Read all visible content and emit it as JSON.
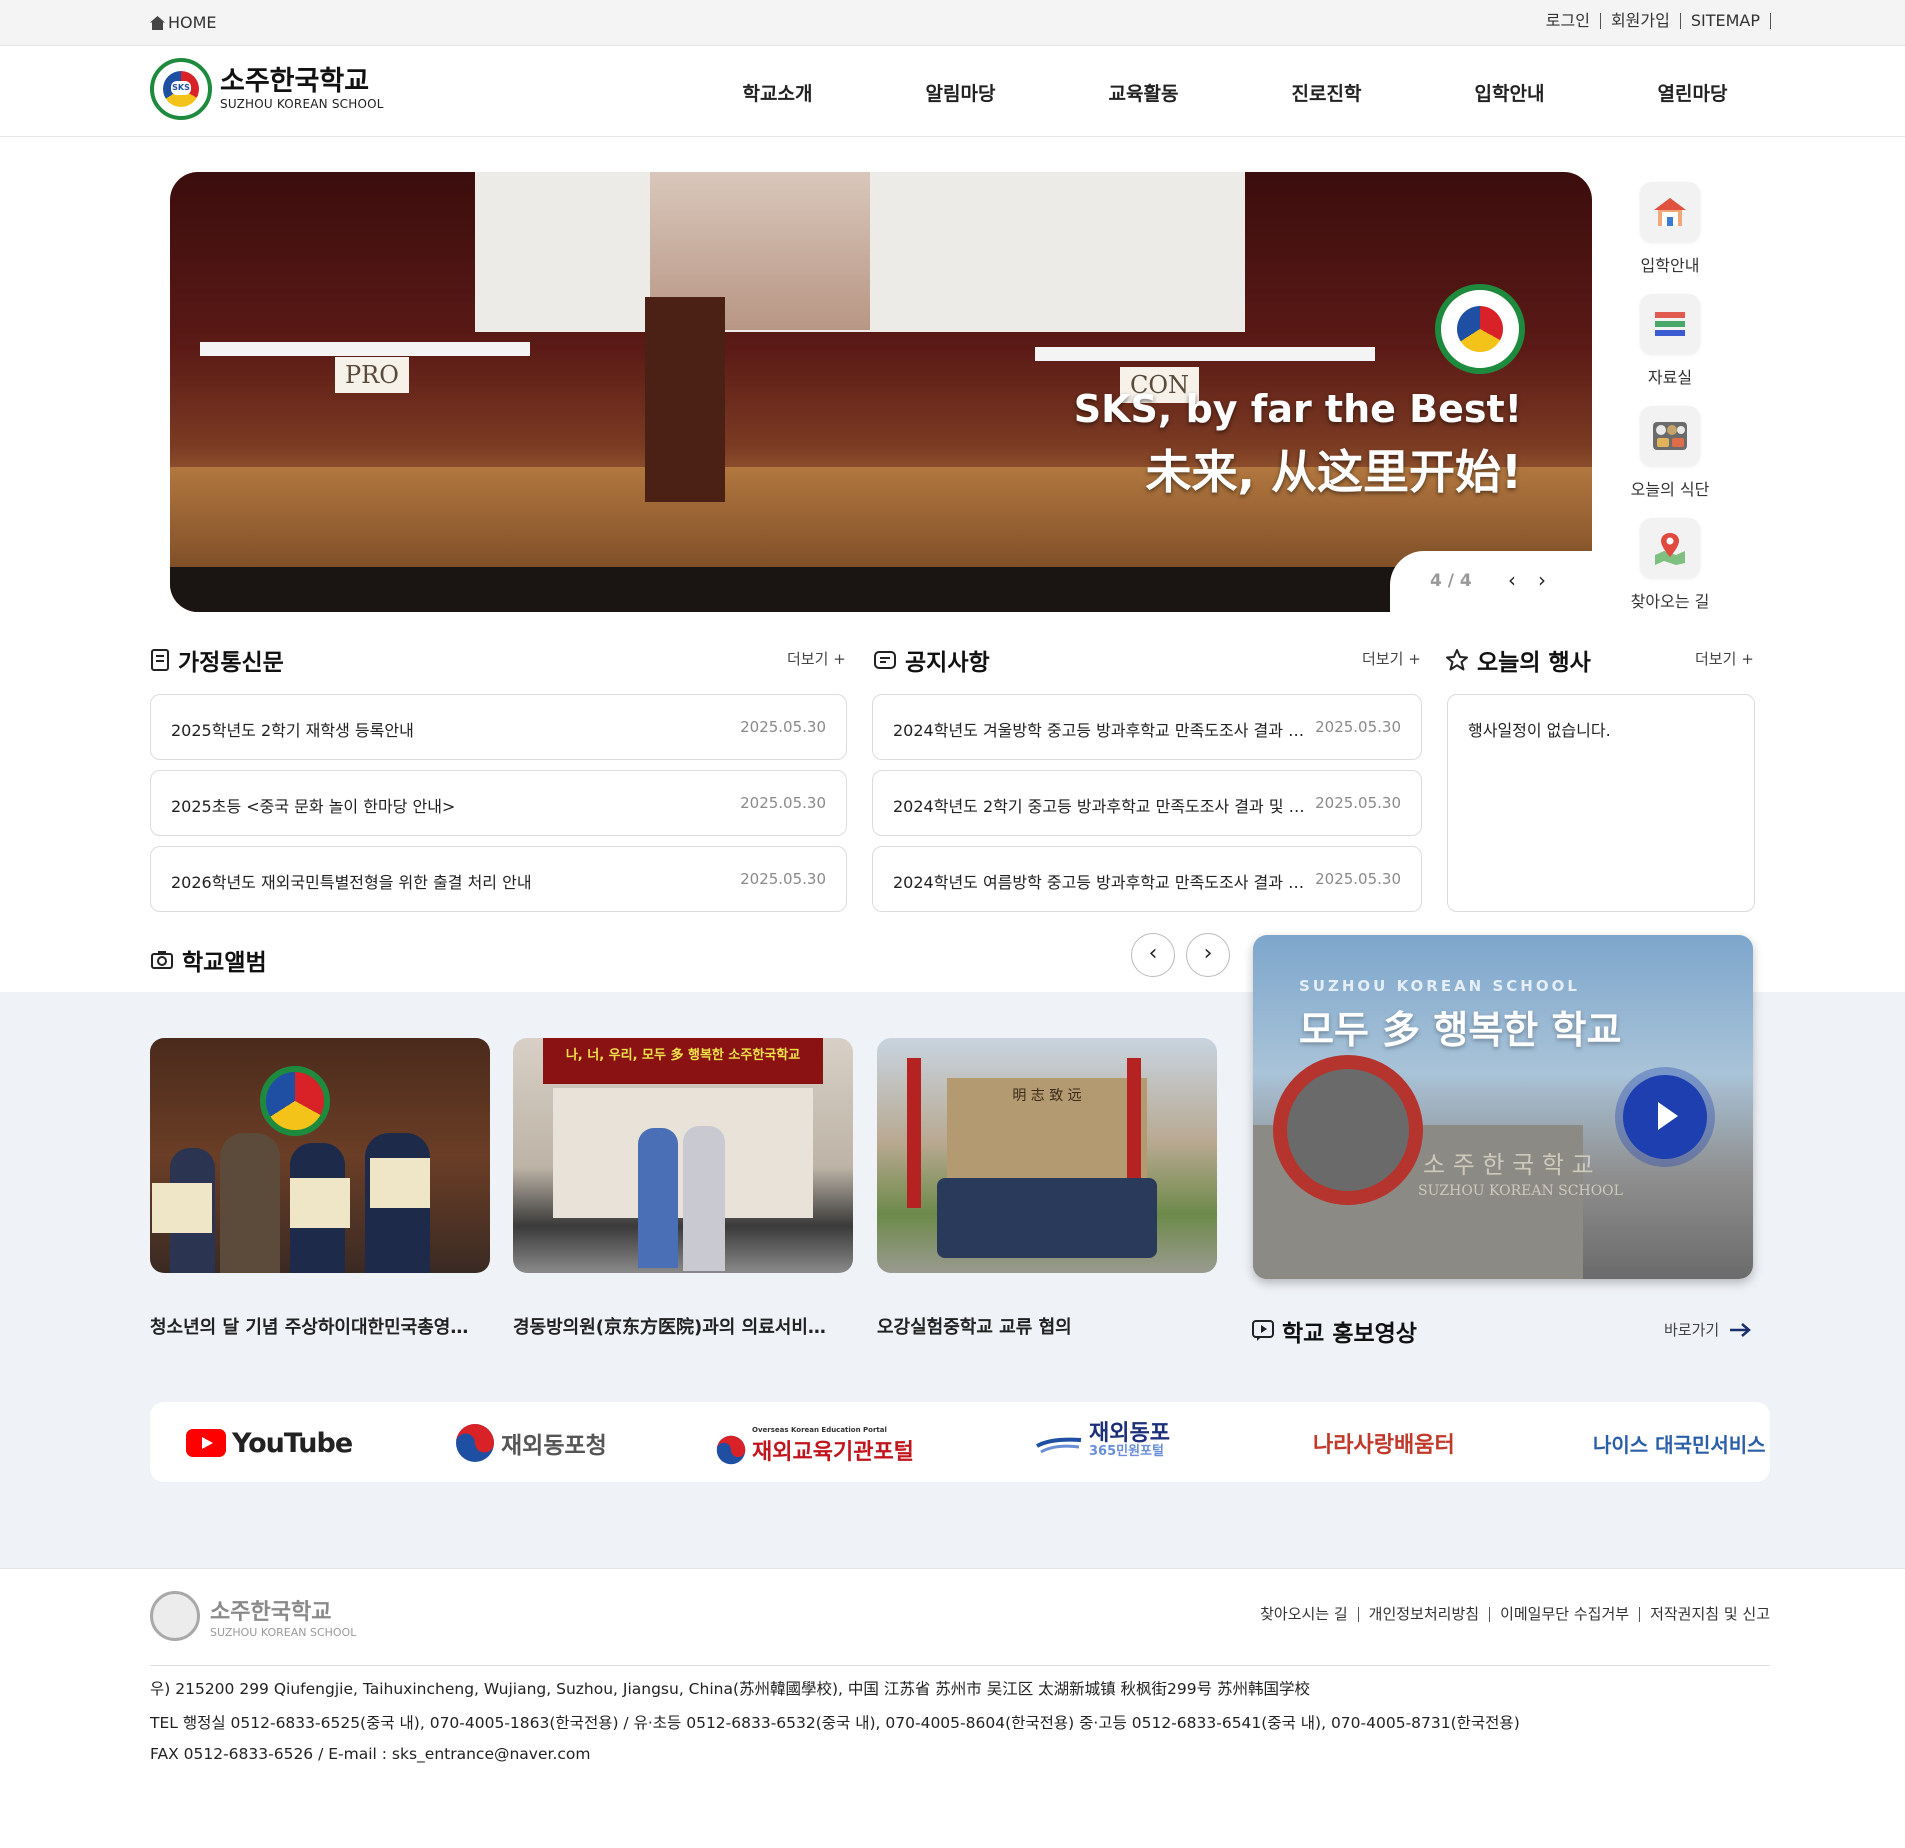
{
  "topbar": {
    "home": "HOME",
    "util": [
      "로그인",
      "회원가입",
      "SITEMAP"
    ]
  },
  "header": {
    "name_ko": "소주한국학교",
    "name_en": "SUZHOU KOREAN SCHOOL",
    "emblem_text": "SKS",
    "nav": [
      "학교소개",
      "알림마당",
      "교육활동",
      "진로진학",
      "입학안내",
      "열린마당"
    ]
  },
  "hero": {
    "slogan_en": "SKS, by far the Best!",
    "slogan_zh": "未来, 从这里开始!",
    "sign_pro": "PRO",
    "sign_con": "CON",
    "counter": "4 / 4",
    "prev_icon": "chevron-left-icon",
    "next_icon": "chevron-right-icon"
  },
  "quick": [
    {
      "label": "입학안내",
      "icon": "school-icon"
    },
    {
      "label": "자료실",
      "icon": "books-icon"
    },
    {
      "label": "오늘의 식단",
      "icon": "meal-tray-icon"
    },
    {
      "label": "찾아오는 길",
      "icon": "map-pin-icon"
    }
  ],
  "boards": {
    "newsletter": {
      "title": "가정통신문",
      "more": "더보기",
      "items": [
        {
          "title": "2025학년도 2학기 재학생 등록안내",
          "date": "2025.05.30"
        },
        {
          "title": "2025초등 <중국 문화 놀이 한마당 안내>",
          "date": "2025.05.30"
        },
        {
          "title": "2026학년도 재외국민특별전형을 위한 출결 처리 안내",
          "date": "2025.05.30"
        }
      ]
    },
    "notice": {
      "title": "공지사항",
      "more": "더보기",
      "items": [
        {
          "title": "2024학년도 겨울방학 중고등 방과후학교 만족도조사 결과 및 …",
          "date": "2025.05.30"
        },
        {
          "title": "2024학년도 2학기 중고등 방과후학교 만족도조사 결과 및 교…",
          "date": "2025.05.30"
        },
        {
          "title": "2024학년도 여름방학 중고등 방과후학교 만족도조사 결과 및 …",
          "date": "2025.05.30"
        }
      ]
    },
    "events": {
      "title": "오늘의 행사",
      "more": "더보기",
      "empty": "행사일정이 없습니다."
    }
  },
  "album": {
    "title": "학교앨범",
    "prev": "‹",
    "next": "›",
    "items": [
      {
        "caption": "청소년의 달 기념 주상하이대한민국총영…"
      },
      {
        "caption": "경동방의원(京东方医院)과의 의료서비…"
      },
      {
        "caption": "오강실험중학교 교류 협의"
      }
    ],
    "photo2_banner": "나, 너, 우리, 모두 多 행복한 소주한국학교",
    "photo3_banner": "明 志 致 远"
  },
  "video": {
    "sub": "SUZHOU KOREAN SCHOOL",
    "main": "모두 多 행복한 학교",
    "wall_ko": "소 주 한 국 학 교",
    "wall_en": "SUZHOU KOREAN SCHOOL",
    "section_title": "학교 홍보영상",
    "goto": "바로가기"
  },
  "banners": [
    {
      "label": "YouTube"
    },
    {
      "label": "재외동포청"
    },
    {
      "label": "재외교육기관포털",
      "sub": "Overseas Korean Education Portal"
    },
    {
      "label": "재외동포",
      "sub": "365민원포털"
    },
    {
      "label": "나라사랑배움터"
    },
    {
      "label": "나이스 대국민서비스"
    }
  ],
  "footer": {
    "name_ko": "소주한국학교",
    "name_en": "SUZHOU KOREAN SCHOOL",
    "links": [
      "찾아오시는 길",
      "개인정보처리방침",
      "이메일무단 수집거부",
      "저작권지침 및 신고"
    ],
    "address": "우) 215200 299 Qiufengjie, Taihuxincheng, Wujiang, Suzhou, Jiangsu, China(苏州韓國學校), 中国 江苏省 苏州市 吴江区 太湖新城镇 秋枫街299号 苏州韩国学校",
    "tel": "TEL 행정실 0512-6833-6525(중국 내), 070-4005-1863(한국전용) / 유·초등 0512-6833-6532(중국 내), 070-4005-8604(한국전용) 중·고등 0512-6833-6541(중국 내), 070-4005-8731(한국전용)",
    "fax": "FAX 0512-6833-6526 / E-mail : sks_entrance@naver.com"
  }
}
